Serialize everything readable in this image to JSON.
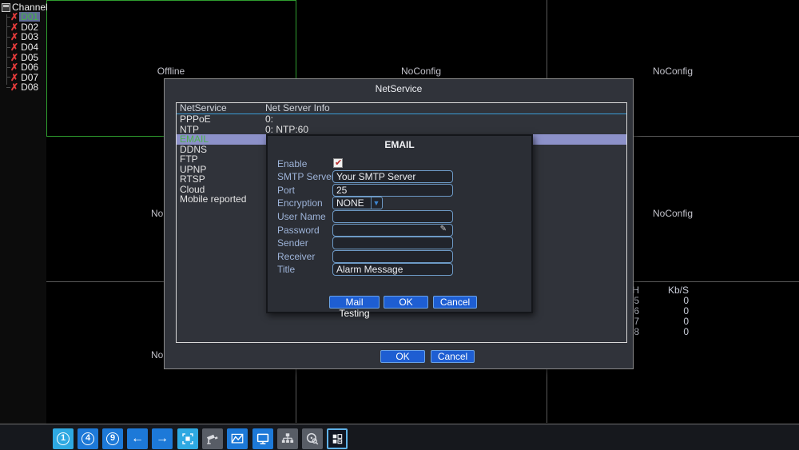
{
  "sidebar": {
    "title": "Channel",
    "channels": [
      {
        "label": "D01",
        "selected": true
      },
      {
        "label": "D02"
      },
      {
        "label": "D03"
      },
      {
        "label": "D04"
      },
      {
        "label": "D05"
      },
      {
        "label": "D06"
      },
      {
        "label": "D07"
      },
      {
        "label": "D08"
      }
    ]
  },
  "grid": {
    "cell_labels": {
      "r1c1": "Offline",
      "r1c2": "NoConfig",
      "r1c3": "NoConfig",
      "r2c1": "NoConfig",
      "r2c3": "NoConfig",
      "r3c1": "NoConfig"
    },
    "bitrate": {
      "header_ch": "CH",
      "header_kbs": "Kb/S",
      "rows": [
        [
          "5",
          "0"
        ],
        [
          "6",
          "0"
        ],
        [
          "7",
          "0"
        ],
        [
          "8",
          "0"
        ]
      ]
    }
  },
  "netservice": {
    "title": "NetService",
    "table_headers": {
      "col1": "NetService",
      "col2": "Net Server Info"
    },
    "services": [
      {
        "name": "PPPoE",
        "info": "0:"
      },
      {
        "name": "NTP",
        "info": "0: NTP:60"
      },
      {
        "name": "EMAIL",
        "info": "",
        "selected": true
      },
      {
        "name": "DDNS",
        "info": ""
      },
      {
        "name": "FTP",
        "info": ""
      },
      {
        "name": "UPNP",
        "info": ""
      },
      {
        "name": "RTSP",
        "info": ""
      },
      {
        "name": "Cloud",
        "info": ""
      },
      {
        "name": "Mobile reported",
        "info": ""
      }
    ],
    "ok_label": "OK",
    "cancel_label": "Cancel"
  },
  "email": {
    "title": "EMAIL",
    "enable_label": "Enable",
    "enable_checked": true,
    "smtp_label": "SMTP Server",
    "smtp_value": "Your SMTP Server",
    "port_label": "Port",
    "port_value": "25",
    "encryption_label": "Encryption",
    "encryption_value": "NONE",
    "username_label": "User Name",
    "username_value": "",
    "password_label": "Password",
    "password_value": "",
    "sender_label": "Sender",
    "sender_value": "",
    "receiver_label": "Receiver",
    "receiver_value": "",
    "title_label": "Title",
    "title_value": "Alarm Message",
    "mail_testing_label": "Mail Testing",
    "ok_label": "OK",
    "cancel_label": "Cancel"
  },
  "toolbar": {
    "buttons": [
      {
        "label": "1",
        "icon": "single-view-icon"
      },
      {
        "label": "4",
        "icon": "quad-view-icon"
      },
      {
        "label": "9",
        "icon": "nine-view-icon"
      },
      {
        "icon": "prev-arrow-icon"
      },
      {
        "icon": "next-arrow-icon"
      },
      {
        "icon": "stop-icon"
      },
      {
        "icon": "ptz-camera-icon"
      },
      {
        "icon": "chart-icon"
      },
      {
        "icon": "monitor-icon"
      },
      {
        "icon": "network-icon"
      },
      {
        "icon": "disk-search-icon"
      },
      {
        "icon": "multi-pip-icon"
      }
    ]
  },
  "colors": {
    "accent_blue": "#1d79d8",
    "accent_light_blue": "#2ea9e2",
    "highlight_purple": "#8c91c9",
    "selected_green": "#46b246",
    "error_red": "#e13b3b",
    "input_border": "#6d9ac6"
  }
}
